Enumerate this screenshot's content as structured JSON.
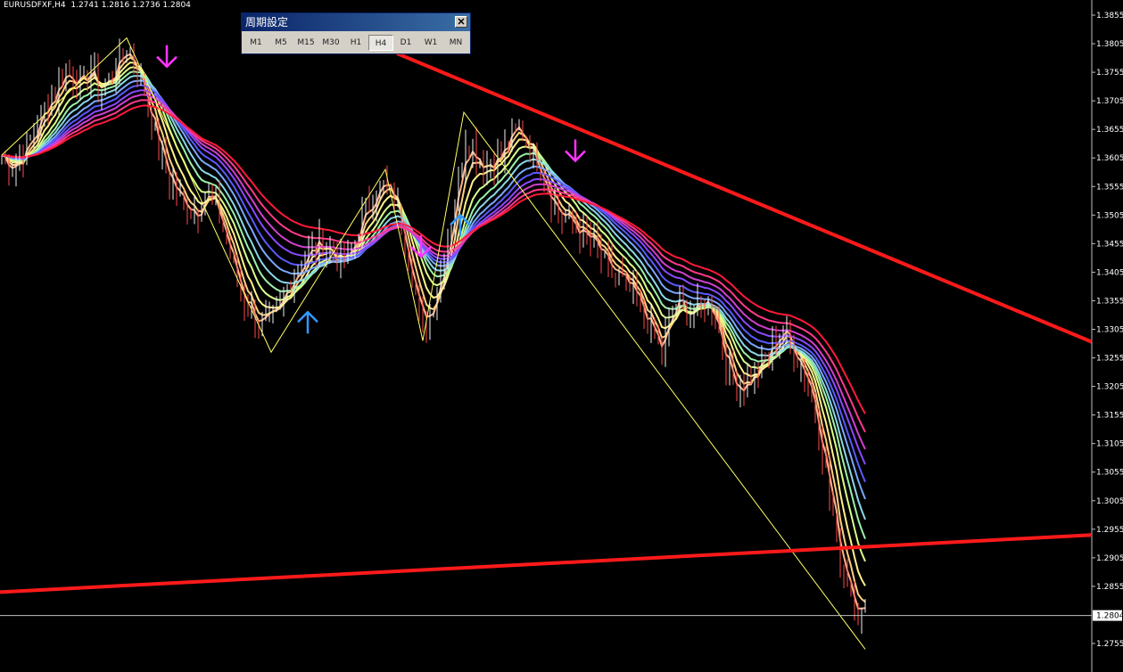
{
  "symbol_info": "EURUSDFXF,H4  1.2741 1.2816 1.2736 1.2804",
  "period_panel": {
    "title": "周期設定",
    "buttons": [
      "M1",
      "M5",
      "M15",
      "M30",
      "H1",
      "H4",
      "D1",
      "W1",
      "MN"
    ],
    "active": "H4"
  },
  "chart_data": {
    "type": "line",
    "ylim": [
      1.2725,
      1.3885
    ],
    "yticks": [
      "1.3855",
      "1.3805",
      "1.3755",
      "1.3705",
      "1.3655",
      "1.3605",
      "1.3555",
      "1.3505",
      "1.3455",
      "1.3405",
      "1.3355",
      "1.3305",
      "1.3255",
      "1.3205",
      "1.3155",
      "1.3105",
      "1.3055",
      "1.3005",
      "1.2955",
      "1.2905",
      "1.2855",
      "1.2755"
    ],
    "current_price": "1.2804",
    "price_series": [
      [
        0,
        1.361
      ],
      [
        10,
        1.359
      ],
      [
        20,
        1.36
      ],
      [
        30,
        1.363
      ],
      [
        40,
        1.366
      ],
      [
        50,
        1.37
      ],
      [
        60,
        1.372
      ],
      [
        70,
        1.376
      ],
      [
        80,
        1.375
      ],
      [
        90,
        1.373
      ],
      [
        100,
        1.376
      ],
      [
        110,
        1.372
      ],
      [
        120,
        1.374
      ],
      [
        130,
        1.377
      ],
      [
        140,
        1.38
      ],
      [
        150,
        1.377
      ],
      [
        160,
        1.372
      ],
      [
        170,
        1.366
      ],
      [
        180,
        1.36
      ],
      [
        190,
        1.356
      ],
      [
        200,
        1.353
      ],
      [
        210,
        1.352
      ],
      [
        220,
        1.351
      ],
      [
        230,
        1.355
      ],
      [
        240,
        1.352
      ],
      [
        250,
        1.347
      ],
      [
        260,
        1.341
      ],
      [
        270,
        1.336
      ],
      [
        280,
        1.334
      ],
      [
        290,
        1.331
      ],
      [
        300,
        1.332
      ],
      [
        310,
        1.333
      ],
      [
        320,
        1.338
      ],
      [
        330,
        1.341
      ],
      [
        340,
        1.343
      ],
      [
        350,
        1.345
      ],
      [
        360,
        1.346
      ],
      [
        370,
        1.344
      ],
      [
        380,
        1.342
      ],
      [
        390,
        1.343
      ],
      [
        400,
        1.348
      ],
      [
        410,
        1.352
      ],
      [
        420,
        1.355
      ],
      [
        430,
        1.356
      ],
      [
        440,
        1.353
      ],
      [
        450,
        1.348
      ],
      [
        460,
        1.34
      ],
      [
        470,
        1.331
      ],
      [
        480,
        1.333
      ],
      [
        490,
        1.339
      ],
      [
        500,
        1.346
      ],
      [
        510,
        1.355
      ],
      [
        520,
        1.364
      ],
      [
        530,
        1.362
      ],
      [
        540,
        1.359
      ],
      [
        550,
        1.36
      ],
      [
        560,
        1.361
      ],
      [
        570,
        1.364
      ],
      [
        580,
        1.366
      ],
      [
        590,
        1.363
      ],
      [
        600,
        1.36
      ],
      [
        610,
        1.356
      ],
      [
        620,
        1.352
      ],
      [
        630,
        1.35
      ],
      [
        640,
        1.349
      ],
      [
        650,
        1.347
      ],
      [
        660,
        1.346
      ],
      [
        670,
        1.344
      ],
      [
        680,
        1.341
      ],
      [
        690,
        1.34
      ],
      [
        700,
        1.338
      ],
      [
        710,
        1.336
      ],
      [
        720,
        1.333
      ],
      [
        730,
        1.33
      ],
      [
        740,
        1.326
      ],
      [
        750,
        1.333
      ],
      [
        760,
        1.336
      ],
      [
        770,
        1.333
      ],
      [
        780,
        1.334
      ],
      [
        790,
        1.336
      ],
      [
        800,
        1.333
      ],
      [
        810,
        1.326
      ],
      [
        820,
        1.321
      ],
      [
        830,
        1.32
      ],
      [
        840,
        1.322
      ],
      [
        850,
        1.324
      ],
      [
        860,
        1.326
      ],
      [
        870,
        1.33
      ],
      [
        880,
        1.33
      ],
      [
        890,
        1.326
      ],
      [
        900,
        1.323
      ],
      [
        910,
        1.318
      ],
      [
        920,
        1.309
      ],
      [
        930,
        1.3
      ],
      [
        940,
        1.29
      ],
      [
        950,
        1.286
      ],
      [
        960,
        1.281
      ],
      [
        968,
        1.2804
      ]
    ],
    "zigzag": [
      [
        0,
        1.361
      ],
      [
        140,
        1.3815
      ],
      [
        302,
        1.3265
      ],
      [
        430,
        1.3585
      ],
      [
        472,
        1.3285
      ],
      [
        518,
        1.3685
      ],
      [
        968,
        1.2745
      ]
    ],
    "trendlines": [
      {
        "name": "resistance",
        "points": [
          [
            445,
            1.3788
          ],
          [
            1224,
            1.3283
          ]
        ],
        "color": "#ff1a1a"
      },
      {
        "name": "support",
        "points": [
          [
            0,
            1.2845
          ],
          [
            1224,
            1.2945
          ]
        ],
        "color": "#ff1a1a"
      }
    ],
    "signals": [
      {
        "type": "sell",
        "x": 187,
        "price": 1.3765,
        "color": "#ff33ff"
      },
      {
        "type": "buy",
        "x": 345,
        "price": 1.3335,
        "color": "#3399ff"
      },
      {
        "type": "sell",
        "x": 472,
        "price": 1.3432,
        "color": "#ff33ff"
      },
      {
        "type": "buy",
        "x": 516,
        "price": 1.3505,
        "color": "#3399ff"
      },
      {
        "type": "sell",
        "x": 645,
        "price": 1.36,
        "color": "#ff33ff"
      }
    ],
    "ribbon_colors": [
      "#ffb38a",
      "#ffd080",
      "#fff28a",
      "#d9ff8a",
      "#9cf0a8",
      "#8ad8e8",
      "#7aa8ff",
      "#5a5aff",
      "#8a4aff",
      "#d040d0",
      "#ff3a8a",
      "#ff1a3a"
    ]
  }
}
